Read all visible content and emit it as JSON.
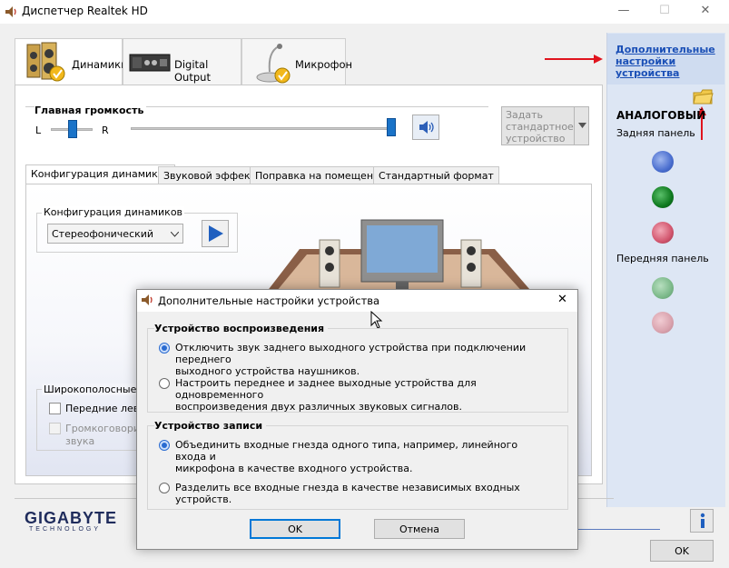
{
  "window": {
    "title": "Диспетчер Realtek HD",
    "minimize": "—",
    "maximize": "☐",
    "close": "✕"
  },
  "device_tabs": [
    {
      "label": "Динамики",
      "icon": "speakers-icon"
    },
    {
      "label": "Digital Output",
      "icon": "digital-output-icon"
    },
    {
      "label": "Микрофон",
      "icon": "microphone-icon"
    }
  ],
  "volume": {
    "title": "Главная громкость",
    "left": "L",
    "right": "R",
    "balance": 0.5,
    "level": 1.0,
    "default_device": "Задать стандартное устройство"
  },
  "sub_tabs": [
    "Конфигурация динамиков",
    "Звуковой эффект",
    "Поправка на помещение",
    "Стандартный формат"
  ],
  "speaker_config": {
    "group_title": "Конфигурация динамиков",
    "selected": "Стереофонический"
  },
  "fullrange": {
    "group_title": "Широкополосные гр",
    "front_label": "Передние левы",
    "surround_label_line1": "Громкоговорит",
    "surround_label_line2": "звука"
  },
  "side": {
    "advanced_link_line1": "Дополнительные",
    "advanced_link_line2": "настройки",
    "advanced_link_line3": "устройства",
    "analog": "АНАЛОГОВЫЙ",
    "back_panel": "Задняя панель",
    "front_panel": "Передняя панель",
    "colors": {
      "blue": "#5b7fd0",
      "green": "#1c8a2a",
      "pink": "#d06c80",
      "green_dim": "#7cb98a",
      "pink_dim": "#d9a2ad"
    }
  },
  "brand": {
    "name": "GIGABYTE",
    "sub": "TECHNOLOGY"
  },
  "main_ok": "OK",
  "dialog": {
    "title": "Дополнительные настройки устройства",
    "playback": {
      "title": "Устройство воспроизведения",
      "opt1_line1": "Отключить звук заднего выходного устройства при подключении переднего",
      "opt1_line2": "выходного устройства наушников.",
      "opt2_line1": "Настроить переднее и заднее выходные устройства для одновременного",
      "opt2_line2": "воспроизведения двух различных звуковых сигналов.",
      "selected": 1
    },
    "record": {
      "title": "Устройство записи",
      "opt1_line1": "Объединить входные гнезда одного типа, например, линейного входа и",
      "opt1_line2": "микрофона в качестве входного устройства.",
      "opt2": "Разделить все входные гнезда в качестве независимых входных устройств.",
      "selected": 1
    },
    "ok": "OK",
    "cancel": "Отмена",
    "close": "✕"
  }
}
